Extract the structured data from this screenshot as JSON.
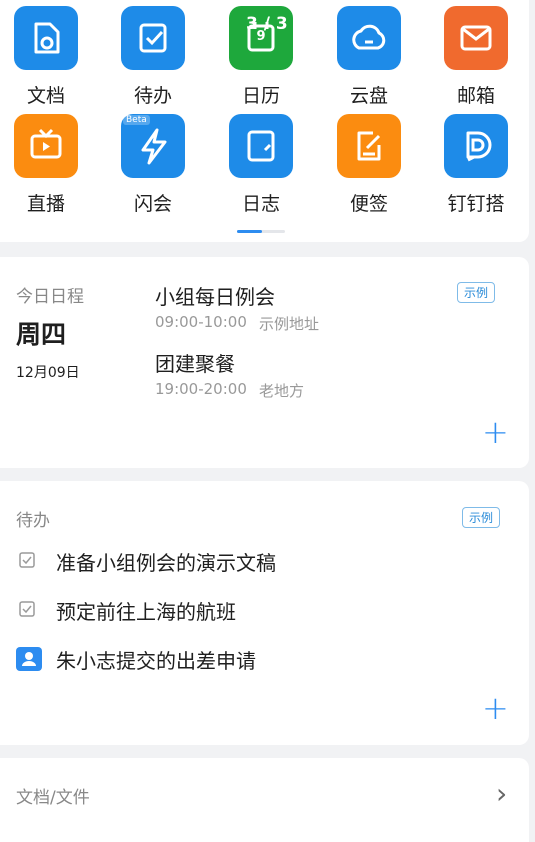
{
  "apps": [
    {
      "label": "文档",
      "icon": "document-icon",
      "color": "#1e8be8"
    },
    {
      "label": "待办",
      "icon": "todo-check-icon",
      "color": "#1e8be8"
    },
    {
      "label": "日历",
      "icon": "calendar-icon",
      "color": "#1ea83c",
      "overlay": "3 / 3",
      "day": "9"
    },
    {
      "label": "云盘",
      "icon": "cloud-icon",
      "color": "#1e8be8"
    },
    {
      "label": "邮箱",
      "icon": "mail-icon",
      "color": "#f06a2e"
    },
    {
      "label": "直播",
      "icon": "live-tv-icon",
      "color": "#fb8c10"
    },
    {
      "label": "闪会",
      "icon": "flash-meeting-icon",
      "color": "#1e8be8",
      "badge": "Beta"
    },
    {
      "label": "日志",
      "icon": "journal-icon",
      "color": "#1e8be8"
    },
    {
      "label": "便签",
      "icon": "note-icon",
      "color": "#fb8c10"
    },
    {
      "label": "钉钉搭",
      "icon": "dingda-icon",
      "color": "#1e8be8"
    }
  ],
  "schedule": {
    "title": "今日日程",
    "weekday": "周四",
    "date": "12月09日",
    "tag": "示例",
    "events": [
      {
        "title": "小组每日例会",
        "time": "09:00-10:00",
        "place": "示例地址"
      },
      {
        "title": "团建聚餐",
        "time": "19:00-20:00",
        "place": "老地方"
      }
    ],
    "add": "+"
  },
  "todo": {
    "title": "待办",
    "tag": "示例",
    "items": [
      {
        "text": "准备小组例会的演示文稿",
        "icon": "checkbox-icon"
      },
      {
        "text": "预定前往上海的航班",
        "icon": "checkbox-icon"
      },
      {
        "text": "朱小志提交的出差申请",
        "icon": "approval-person-icon"
      }
    ],
    "add": "+"
  },
  "files": {
    "title": "文档/文件",
    "arrow": "›"
  },
  "accent": "#2d8cf0"
}
